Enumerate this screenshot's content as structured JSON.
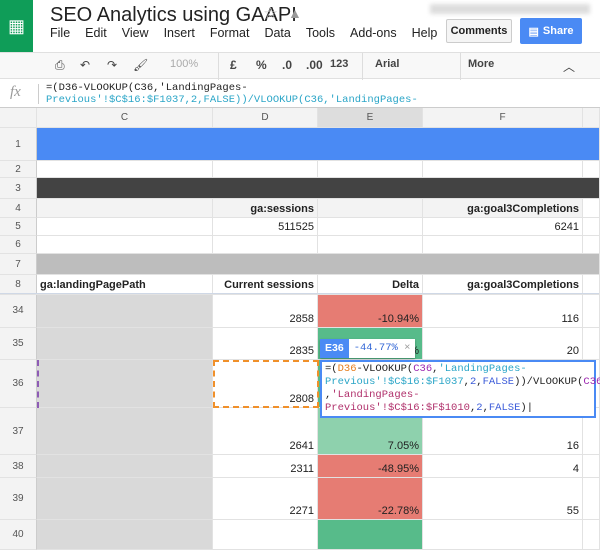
{
  "app": {
    "title": "SEO Analytics using GAAPI",
    "menu": [
      "File",
      "Edit",
      "View",
      "Insert",
      "Format",
      "Data",
      "Tools",
      "Add-ons",
      "Help",
      "..."
    ],
    "comments_label": "Comments",
    "share_label": "Share"
  },
  "toolbar": {
    "zoom": "100%",
    "currency": "£",
    "percent": "%",
    "dec_less": ".0",
    "dec_more": ".00",
    "format": "123",
    "font": "Arial",
    "more": "More"
  },
  "formula_bar": {
    "fx": "fx",
    "line1": "=(D36-VLOOKUP(C36,'LandingPages-",
    "line2": "Previous'!$C$16:$F1037,2,FALSE))/VLOOKUP(C36,'LandingPages-"
  },
  "columns": [
    "C",
    "D",
    "E",
    "F"
  ],
  "colors": {
    "header_blue": "#4a8af4",
    "dark_band": "#434343",
    "gray_band": "#bdbdbd",
    "negative": "#e67c73",
    "positive": "#57bb8a"
  },
  "rows": [
    {
      "n": "1"
    },
    {
      "n": "2"
    },
    {
      "n": "3"
    },
    {
      "n": "4",
      "D": "ga:sessions",
      "F": "ga:goal3Completions"
    },
    {
      "n": "5",
      "D": "511525",
      "F": "6241"
    },
    {
      "n": "6"
    },
    {
      "n": "7"
    },
    {
      "n": "8",
      "C": "ga:landingPagePath",
      "D": "Current sessions",
      "E": "Delta",
      "F": "ga:goal3Completions"
    },
    {
      "n": "34",
      "D": "2858",
      "E": "-10.94%",
      "F": "116"
    },
    {
      "n": "35",
      "D": "2835",
      "E": "%",
      "F": "20"
    },
    {
      "n": "36",
      "D": "2808"
    },
    {
      "n": "37",
      "D": "2641",
      "E": "7.05%",
      "F": "16"
    },
    {
      "n": "38",
      "D": "2311",
      "E": "-48.95%",
      "F": "4"
    },
    {
      "n": "39",
      "D": "2271",
      "E": "-22.78%",
      "F": "55"
    },
    {
      "n": "40"
    }
  ],
  "editor": {
    "cell_ref": "E36",
    "value": "-44.77%",
    "close": "×"
  }
}
